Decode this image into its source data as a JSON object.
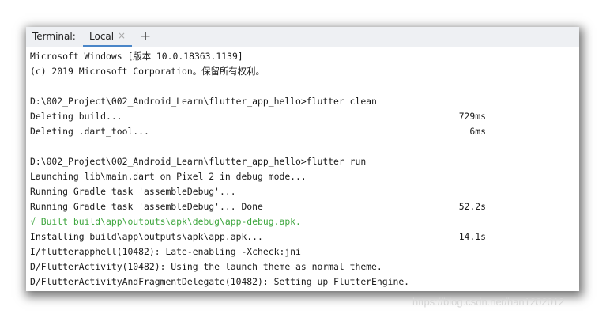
{
  "tabbar": {
    "title": "Terminal:",
    "tab_label": "Local",
    "close_icon": "×",
    "add_icon": "+"
  },
  "console": {
    "lines": [
      "Microsoft Windows [版本 10.0.18363.1139]",
      "(c) 2019 Microsoft Corporation。保留所有权利。",
      "",
      "D:\\002_Project\\002_Android_Learn\\flutter_app_hello>flutter clean",
      "Deleting build...",
      "Deleting .dart_tool...",
      "",
      "D:\\002_Project\\002_Android_Learn\\flutter_app_hello>flutter run",
      "Launching lib\\main.dart on Pixel 2 in debug mode...",
      "Running Gradle task 'assembleDebug'...",
      "Running Gradle task 'assembleDebug'... Done",
      "√ Built build\\app\\outputs\\apk\\debug\\app-debug.apk.",
      "Installing build\\app\\outputs\\apk\\app.apk...",
      "I/flutterapphell(10482): Late-enabling -Xcheck:jni",
      "D/FlutterActivity(10482): Using the launch theme as normal theme.",
      "D/FlutterActivityAndFragmentDelegate(10482): Setting up FlutterEngine."
    ],
    "times": {
      "delete_build": "729ms",
      "delete_dart_tool": "6ms",
      "gradle_done": "52.2s",
      "install": "14.1s"
    }
  },
  "watermark": "https://blog.csdn.net/han1202012",
  "colors": {
    "success_green": "#3fa63f",
    "tab_underline": "#4a86c8",
    "tabbar_bg": "#eef0f3"
  }
}
